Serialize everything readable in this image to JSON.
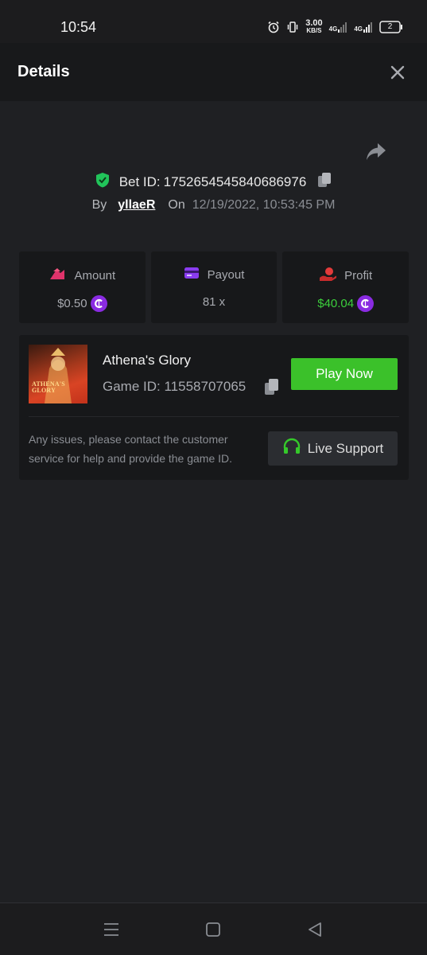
{
  "status_bar": {
    "time": "10:54",
    "net_speed_value": "3.00",
    "net_speed_unit": "KB/S",
    "network_1": "4G",
    "network_2": "4G",
    "battery": "2"
  },
  "header": {
    "title": "Details"
  },
  "bet": {
    "id_label": "Bet ID:",
    "id_value": "1752654545840686976",
    "by_label": "By",
    "username": "yllaeR",
    "on_label": "On",
    "datetime": "12/19/2022, 10:53:45 PM"
  },
  "stats": {
    "amount": {
      "label": "Amount",
      "value": "$0.50"
    },
    "payout": {
      "label": "Payout",
      "value": "81 x"
    },
    "profit": {
      "label": "Profit",
      "value": "$40.04"
    }
  },
  "game": {
    "name": "Athena's Glory",
    "id_label": "Game ID:",
    "id_value": "11558707065",
    "thumb_text_1": "ATHENA'S",
    "thumb_text_2": "GLORY",
    "play_label": "Play Now",
    "help_text": "Any issues, please contact the customer service for help and provide the game ID.",
    "support_label": "Live Support"
  },
  "colors": {
    "background": "#1f2023",
    "card": "#17181a",
    "accent_green": "#3bc12a",
    "profit_green": "#3ccf3c",
    "coin_purple": "#8a2be2",
    "verified_green": "#21c45a"
  },
  "icons": [
    "alarm-icon",
    "vibrate-icon",
    "signal-icon",
    "battery-icon",
    "close-icon",
    "share-icon",
    "verified-shield-icon",
    "copy-icon",
    "amount-icon",
    "payout-card-icon",
    "profit-icon",
    "coin-icon",
    "headset-icon",
    "menu-nav-icon",
    "home-nav-icon",
    "back-nav-icon"
  ]
}
